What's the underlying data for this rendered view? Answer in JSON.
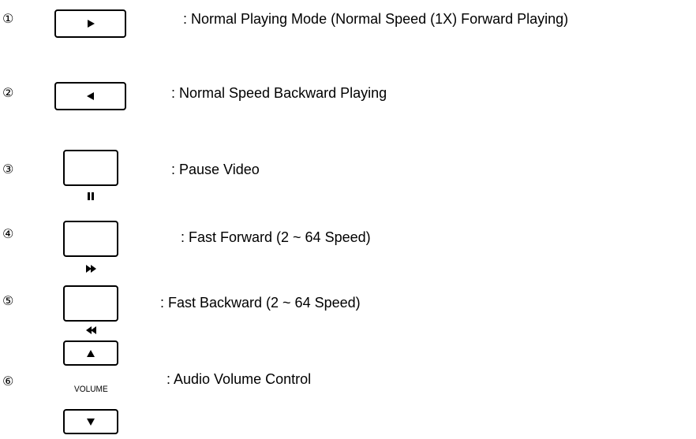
{
  "rows": [
    {
      "number": "①",
      "label": ": Normal Playing Mode (Normal Speed (1X) Forward Playing)",
      "button_icon": "play-forward-icon"
    },
    {
      "number": "②",
      "label": ": Normal Speed Backward Playing",
      "button_icon": "play-backward-icon"
    },
    {
      "number": "③",
      "label": ": Pause Video",
      "button_icon": "pause-icon"
    },
    {
      "number": "④",
      "label": ": Fast Forward (2 ~ 64 Speed)",
      "button_icon": "fast-forward-icon"
    },
    {
      "number": "⑤",
      "label": ": Fast Backward (2 ~ 64 Speed)",
      "button_icon": "fast-backward-icon"
    },
    {
      "number": "⑥",
      "label": ": Audio Volume Control",
      "button_icon": "volume-up-icon / volume-down-icon",
      "volume_caption": "VOLUME"
    }
  ]
}
